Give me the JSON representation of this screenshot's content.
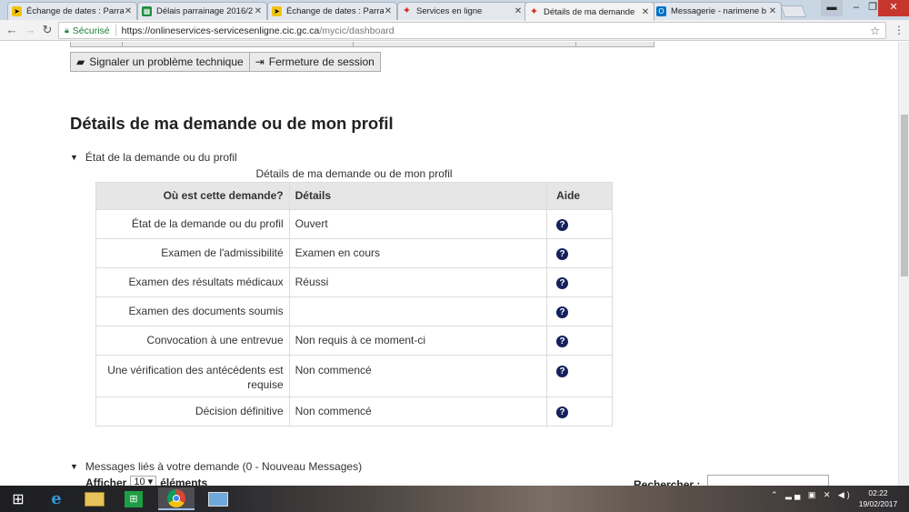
{
  "browser": {
    "tabs": [
      {
        "title": "Échange de dates : Parra",
        "favicon": "yellow-forum-icon",
        "active": false
      },
      {
        "title": "Délais parrainage 2016/2",
        "favicon": "sheets-icon",
        "active": false
      },
      {
        "title": "Échange de dates : Parra",
        "favicon": "yellow-forum-icon",
        "active": false
      },
      {
        "title": "Services en ligne",
        "favicon": "maple-leaf-icon",
        "active": false
      },
      {
        "title": "Détails de ma demande",
        "favicon": "maple-leaf-icon",
        "active": true
      },
      {
        "title": "Messagerie - narimene b",
        "favicon": "outlook-icon",
        "active": false
      }
    ],
    "address": {
      "secure_label": "Sécurisé",
      "url_host": "https://onlineservices-servicesenligne.cic.gc.ca",
      "url_path": "/mycic/dashboard"
    }
  },
  "page": {
    "buttons": {
      "report_problem": "Signaler un problème technique",
      "logout": "Fermeture de session"
    },
    "title": "Détails de ma demande ou de mon profil",
    "status_section": {
      "toggle_label": "État de la demande ou du profil",
      "caption": "Détails de ma demande ou de mon profil",
      "headers": [
        "Où est cette demande?",
        "Détails",
        "Aide"
      ],
      "rows": [
        {
          "item": "État de la demande ou du profil",
          "details": "Ouvert"
        },
        {
          "item": "Examen de l'admissibilité",
          "details": "Examen en cours"
        },
        {
          "item": "Examen des résultats médicaux",
          "details": "Réussi"
        },
        {
          "item": "Examen des documents soumis",
          "details": ""
        },
        {
          "item": "Convocation à une entrevue",
          "details": "Non requis à ce moment-ci"
        },
        {
          "item": "Une vérification des antécédents est requise",
          "details": "Non commencé"
        },
        {
          "item": "Décision définitive",
          "details": "Non commencé"
        }
      ],
      "help_symbol": "?"
    },
    "messages_section": {
      "toggle_label": "Messages liés à votre demande (0 - Nouveau Messages)",
      "show_label": "Afficher",
      "page_size": "10",
      "elements_label": "éléments",
      "search_label": "Rechercher :"
    }
  },
  "taskbar": {
    "clock_time": "02:22",
    "clock_date": "19/02/2017"
  },
  "colors": {
    "help_icon": "#14215c",
    "header_bg": "#e6e6e6",
    "secure_green": "#188038"
  }
}
